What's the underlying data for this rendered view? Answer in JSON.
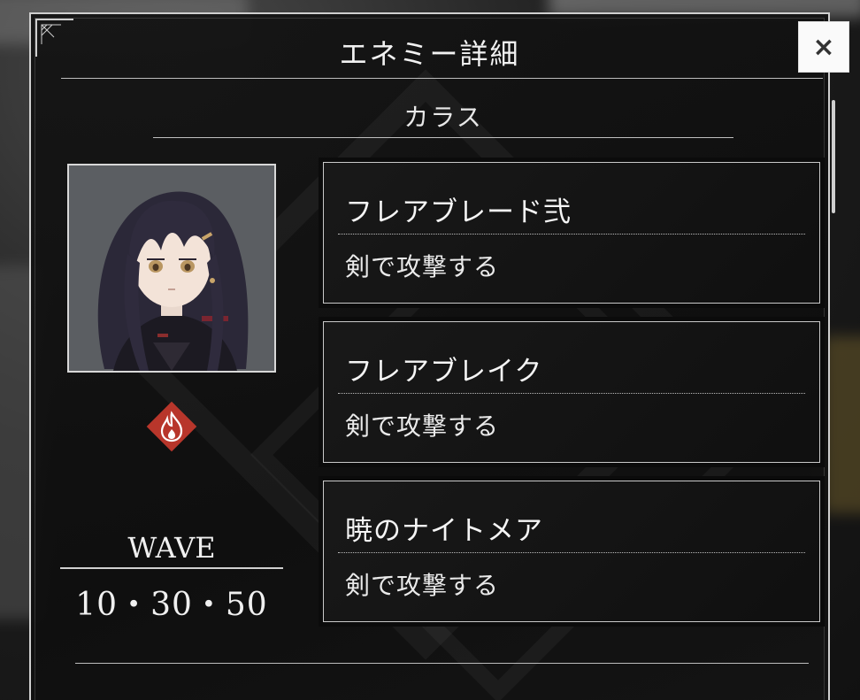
{
  "dialog": {
    "title": "エネミー詳細",
    "close_label": "×"
  },
  "enemy": {
    "name": "カラス",
    "element_icon": "fire-icon",
    "wave_label": "WAVE",
    "wave_values": "10・30・50"
  },
  "skills": [
    {
      "name": "フレアブレード弐",
      "description": "剣で攻撃する"
    },
    {
      "name": "フレアブレイク",
      "description": "剣で攻撃する"
    },
    {
      "name": "暁のナイトメア",
      "description": "剣で攻撃する"
    }
  ],
  "colors": {
    "element_badge": "#b8362b",
    "panel_border": "#cfcfcf",
    "text": "#f0f0f0"
  }
}
